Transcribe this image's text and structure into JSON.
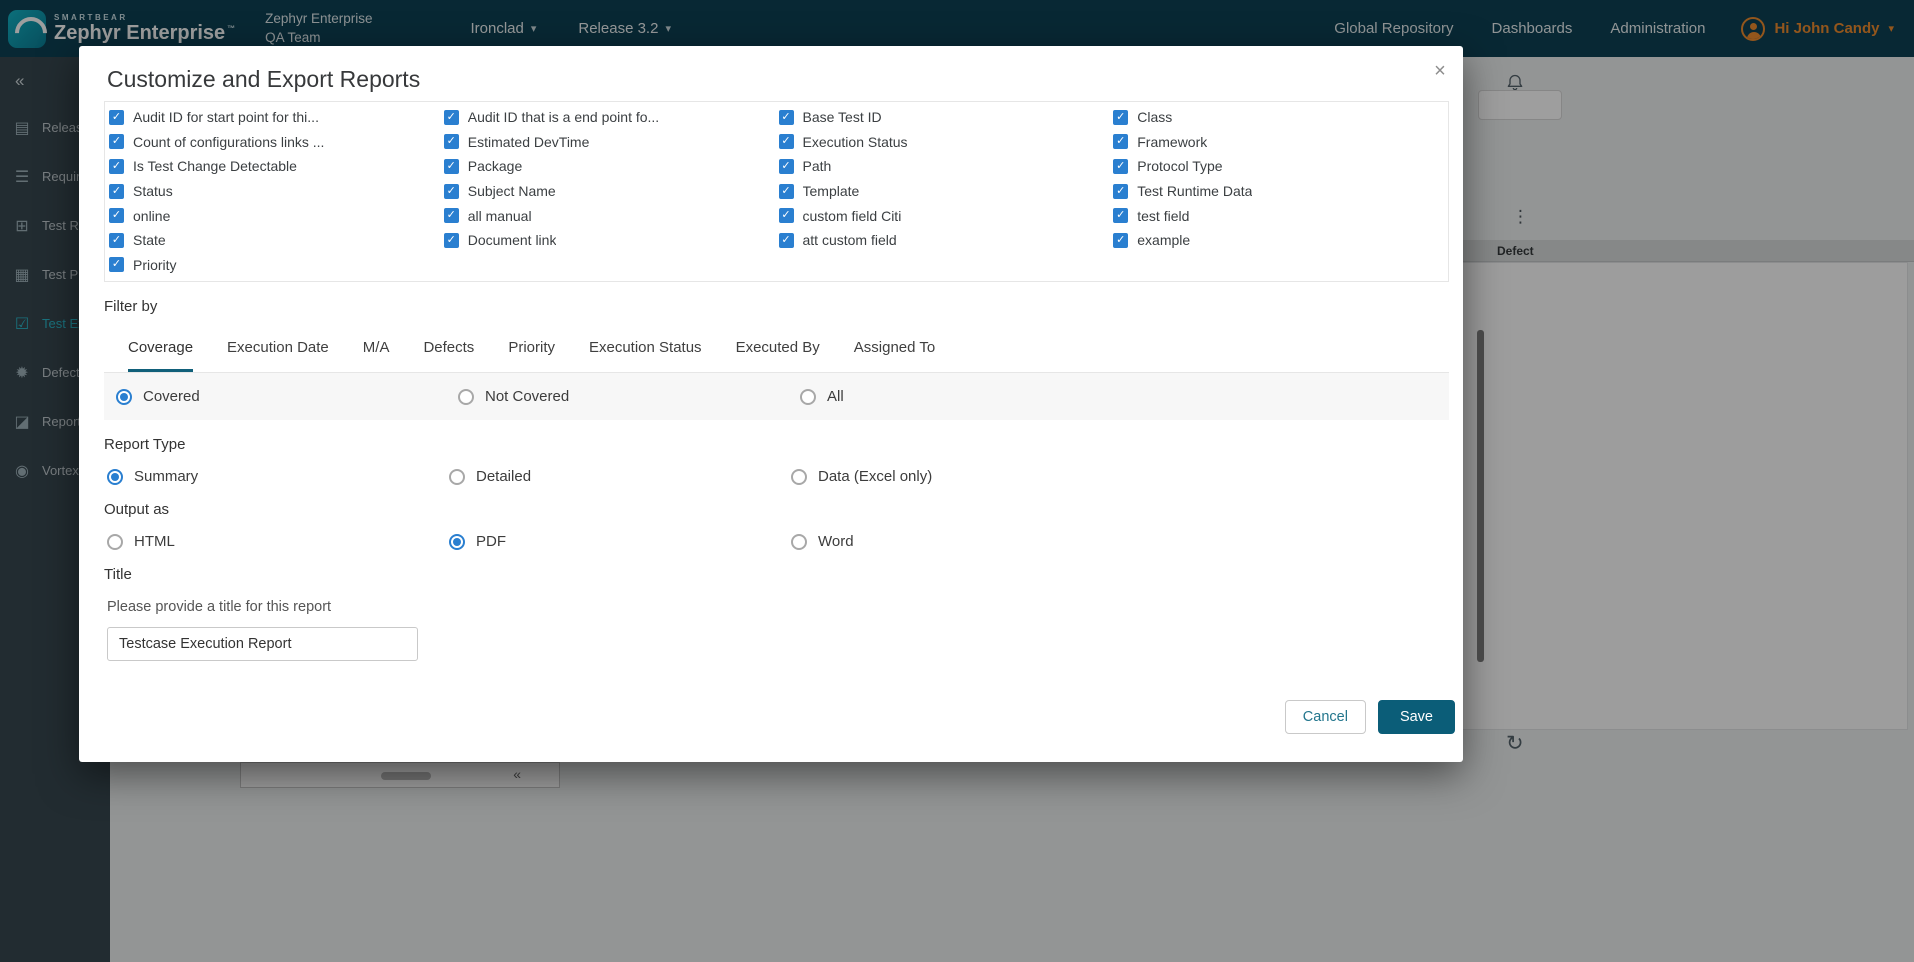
{
  "colors": {
    "topbar-bg": "#0d4255",
    "sidebar-bg": "#37474f",
    "accent": "#2bb9cb",
    "orange": "#ee8b2e",
    "blue": "#2a7fd0",
    "save-bg": "#0b5d78",
    "cancel-text": "#23768d",
    "tab-underline": "#11607a",
    "band-bg": "#f7f7f7",
    "page-bg": "#eef0f1"
  },
  "icons": {
    "chevron_down": "▾",
    "collapse": "«",
    "close": "×",
    "kebab": "⋮",
    "refresh": "↻"
  },
  "topbar": {
    "brand_small": "SMARTBEAR",
    "brand_large": "Zephyr Enterprise",
    "brand_tm": "™",
    "workspace_line1": "Zephyr Enterprise",
    "workspace_line2": "QA Team",
    "project": "Ironclad",
    "release": "Release 3.2",
    "nav": [
      {
        "label": "Global Repository",
        "name": "global-repository"
      },
      {
        "label": "Dashboards",
        "name": "dashboards"
      },
      {
        "label": "Administration",
        "name": "administration"
      }
    ],
    "greeting": "Hi John Candy"
  },
  "sidebar": {
    "items": [
      {
        "label": "Releases",
        "icon": "▤",
        "name": "releases"
      },
      {
        "label": "Requirements",
        "icon": "☰",
        "name": "requirements"
      },
      {
        "label": "Test Repo",
        "icon": "⊞",
        "name": "test-repository"
      },
      {
        "label": "Test Plan",
        "icon": "▦",
        "name": "test-planning"
      },
      {
        "label": "Test Execution",
        "icon": "☑",
        "name": "test-execution",
        "active": true
      },
      {
        "label": "Defects",
        "icon": "✹",
        "name": "defects"
      },
      {
        "label": "Reports",
        "icon": "◪",
        "name": "reports"
      },
      {
        "label": "Vortex",
        "icon": "◉",
        "name": "vortex"
      }
    ]
  },
  "background": {
    "column_header": "Defect"
  },
  "modal": {
    "title": "Customize and Export Reports",
    "fields": [
      {
        "label": "Audit ID for start point for thi...",
        "checked": true
      },
      {
        "label": "Audit ID that is a end point fo...",
        "checked": true
      },
      {
        "label": "Base Test ID",
        "checked": true
      },
      {
        "label": "Class",
        "checked": true
      },
      {
        "label": "Count of configurations links ...",
        "checked": true
      },
      {
        "label": "Estimated DevTime",
        "checked": true
      },
      {
        "label": "Execution Status",
        "checked": true
      },
      {
        "label": "Framework",
        "checked": true
      },
      {
        "label": "Is Test Change Detectable",
        "checked": true
      },
      {
        "label": "Package",
        "checked": true
      },
      {
        "label": "Path",
        "checked": true
      },
      {
        "label": "Protocol Type",
        "checked": true
      },
      {
        "label": "Status",
        "checked": true
      },
      {
        "label": "Subject Name",
        "checked": true
      },
      {
        "label": "Template",
        "checked": true
      },
      {
        "label": "Test Runtime Data",
        "checked": true
      },
      {
        "label": "online",
        "checked": true
      },
      {
        "label": "all manual",
        "checked": true
      },
      {
        "label": "custom field Citi",
        "checked": true
      },
      {
        "label": "test field",
        "checked": true
      },
      {
        "label": "State",
        "checked": true
      },
      {
        "label": "Document link",
        "checked": true
      },
      {
        "label": "att custom field",
        "checked": true
      },
      {
        "label": "example",
        "checked": true
      },
      {
        "label": "Priority",
        "checked": true
      }
    ],
    "filter_by_label": "Filter by",
    "tabs": [
      {
        "label": "Coverage",
        "name": "coverage",
        "active": true
      },
      {
        "label": "Execution Date",
        "name": "execution-date"
      },
      {
        "label": "M/A",
        "name": "ma"
      },
      {
        "label": "Defects",
        "name": "defects"
      },
      {
        "label": "Priority",
        "name": "priority"
      },
      {
        "label": "Execution Status",
        "name": "execution-status"
      },
      {
        "label": "Executed By",
        "name": "executed-by"
      },
      {
        "label": "Assigned To",
        "name": "assigned-to"
      }
    ],
    "coverage_options": [
      {
        "label": "Covered",
        "name": "covered",
        "selected": true
      },
      {
        "label": "Not Covered",
        "name": "not-covered"
      },
      {
        "label": "All",
        "name": "all"
      }
    ],
    "report_type_label": "Report Type",
    "report_type_options": [
      {
        "label": "Summary",
        "name": "summary",
        "selected": true
      },
      {
        "label": "Detailed",
        "name": "detailed"
      },
      {
        "label": "Data (Excel only)",
        "name": "data-excel-only"
      }
    ],
    "output_as_label": "Output as",
    "output_options": [
      {
        "label": "HTML",
        "name": "html"
      },
      {
        "label": "PDF",
        "name": "pdf",
        "selected": true
      },
      {
        "label": "Word",
        "name": "word"
      }
    ],
    "title_label": "Title",
    "title_hint": "Please provide a title for this report",
    "title_value": "Testcase Execution Report",
    "cancel_label": "Cancel",
    "save_label": "Save"
  }
}
